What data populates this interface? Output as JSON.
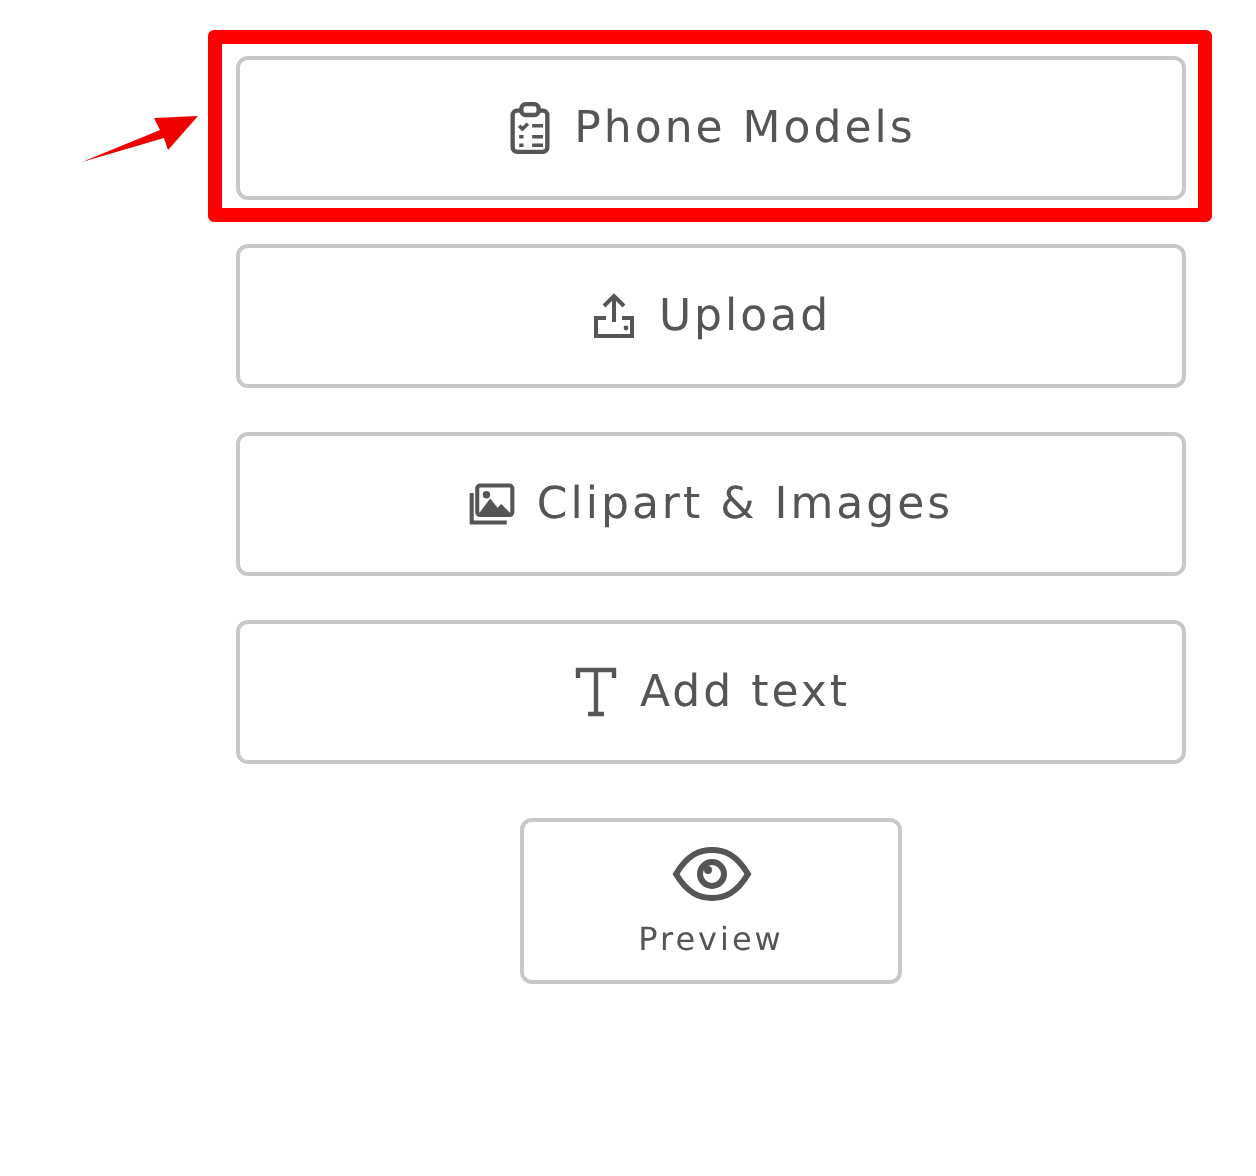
{
  "tools": [
    {
      "kind": "models",
      "label": "Phone Models",
      "highlighted": true
    },
    {
      "kind": "upload",
      "label": "Upload",
      "highlighted": false
    },
    {
      "kind": "clipart",
      "label": "Clipart & Images",
      "highlighted": false
    },
    {
      "kind": "text",
      "label": "Add text",
      "highlighted": false
    }
  ],
  "preview": {
    "label": "Preview"
  }
}
